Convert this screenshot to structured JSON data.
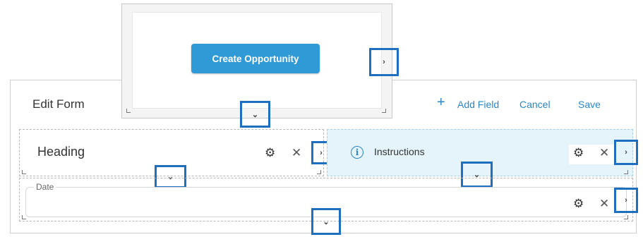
{
  "popup": {
    "create_button_label": "Create Opportunity",
    "expand_right_glyph": "›",
    "expand_down_glyph": "⌄"
  },
  "form": {
    "title": "Edit Form",
    "actions": {
      "add_icon": "+",
      "add_field_label": "Add Field",
      "cancel_label": "Cancel",
      "save_label": "Save"
    }
  },
  "fields": {
    "heading": {
      "label": "Heading",
      "settings_icon": "⚙",
      "remove_icon": "✕",
      "expand_right_glyph": "›",
      "expand_down_glyph": "⌄"
    },
    "instructions": {
      "label": "Instructions",
      "info_icon": "i",
      "settings_icon": "⚙",
      "remove_icon": "✕",
      "expand_right_glyph": "›",
      "expand_down_glyph": "⌄"
    },
    "date": {
      "label": "Date",
      "value": "",
      "settings_icon": "⚙",
      "remove_icon": "✕",
      "expand_right_glyph": "›",
      "expand_down_glyph": "⌄"
    }
  },
  "colors": {
    "accent": "#2f9ad6",
    "link": "#2b86c5",
    "highlight_box": "#1f6fc1",
    "instructions_bg": "#e5f4fb"
  }
}
